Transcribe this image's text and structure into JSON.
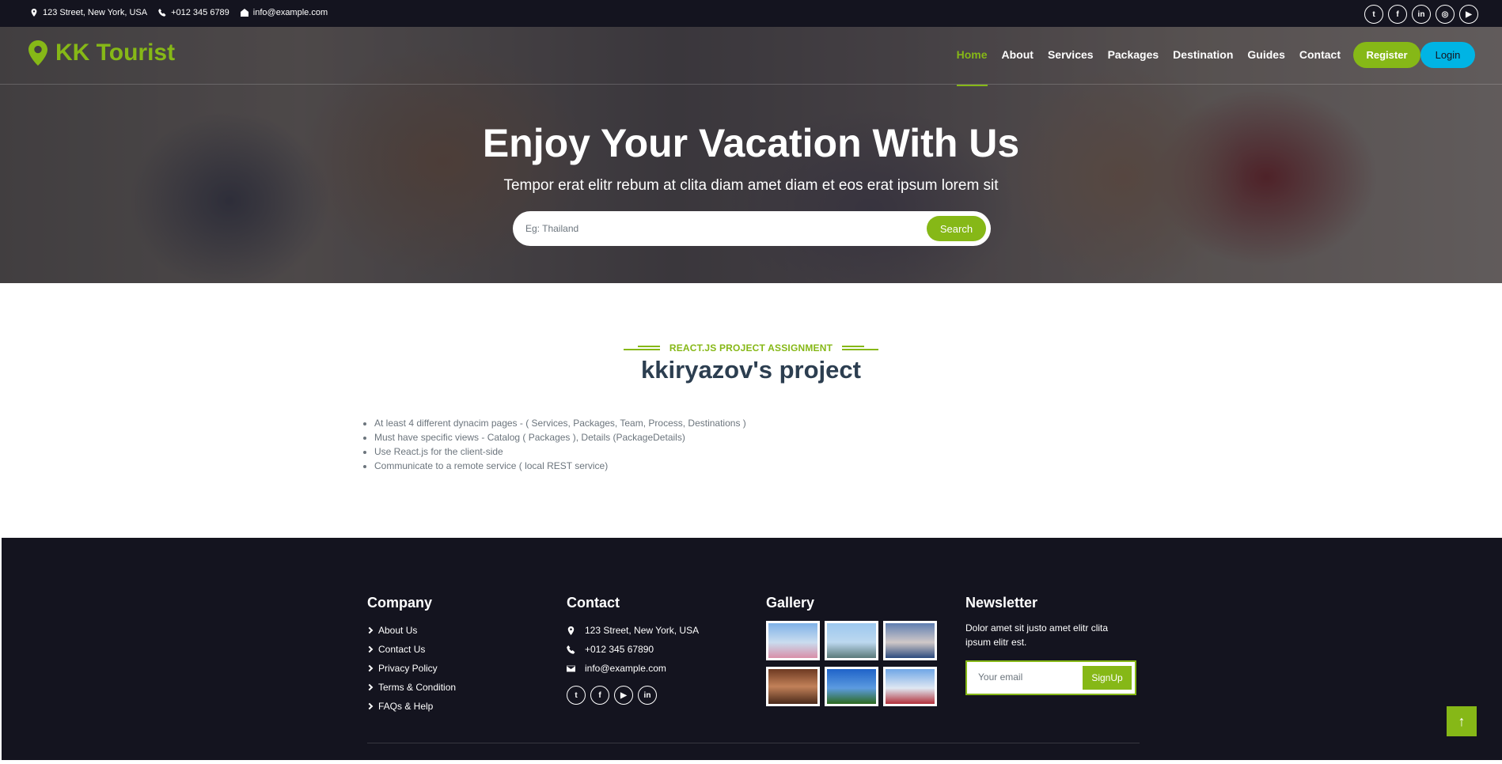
{
  "topbar": {
    "address": "123 Street, New York, USA",
    "phone": "+012 345 6789",
    "email": "info@example.com",
    "social": [
      "twitter-icon",
      "facebook-icon",
      "linkedin-icon",
      "instagram-icon",
      "youtube-icon"
    ]
  },
  "nav": {
    "brand": "KK Tourist",
    "items": [
      "Home",
      "About",
      "Services",
      "Packages",
      "Destination",
      "Guides",
      "Contact"
    ],
    "active": "Home",
    "register_label": "Register",
    "login_label": "Login"
  },
  "hero": {
    "title": "Enjoy Your Vacation With Us",
    "subtitle": "Tempor erat elitr rebum at clita diam amet diam et eos erat ipsum lorem sit",
    "search_placeholder": "Eg: Thailand",
    "search_button": "Search"
  },
  "section": {
    "tag": "REACT.JS PROJECT ASSIGNMENT",
    "title": "kkiryazov's project",
    "requirements": [
      "At least 4 different dynacim pages - ( Services, Packages, Team, Process, Destinations )",
      "Must have specific views - Catalog ( Packages ), Details (PackageDetails)",
      "Use React.js for the client-side",
      "Communicate to a remote service ( local REST service)"
    ]
  },
  "footer": {
    "company_title": "Company",
    "company_links": [
      "About Us",
      "Contact Us",
      "Privacy Policy",
      "Terms & Condition",
      "FAQs & Help"
    ],
    "contact_title": "Contact",
    "contact_address": "123 Street, New York, USA",
    "contact_phone": "+012 345 67890",
    "contact_email": "info@example.com",
    "gallery_title": "Gallery",
    "newsletter_title": "Newsletter",
    "newsletter_text": "Dolor amet sit justo amet elitr clita ipsum elitr est.",
    "newsletter_placeholder": "Your email",
    "newsletter_button": "SignUp"
  },
  "colors": {
    "accent": "#86b817",
    "dark": "#14141f",
    "login": "#00b4e4"
  }
}
